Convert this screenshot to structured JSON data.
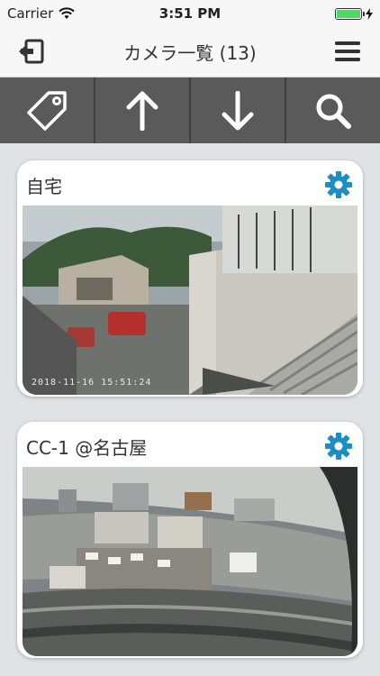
{
  "status": {
    "carrier": "Carrier",
    "time": "3:51 PM"
  },
  "nav": {
    "title": "カメラ一覧 (13)"
  },
  "toolbar": {
    "items": [
      "tag-icon",
      "arrow-up-icon",
      "arrow-down-icon",
      "search-icon"
    ]
  },
  "cameras": [
    {
      "name": "自宅",
      "timestamp": "2018-11-16 15:51:24"
    },
    {
      "name": "CC-1 @名古屋",
      "timestamp": ""
    }
  ],
  "colors": {
    "accent": "#1a8fc4",
    "toolbar": "#5a5a5a",
    "background": "#dfe3e6"
  }
}
